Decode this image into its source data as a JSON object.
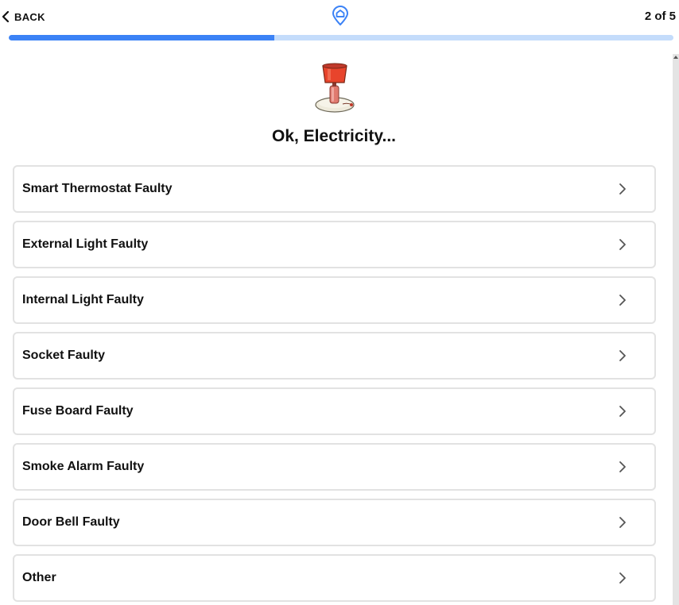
{
  "header": {
    "back_label": "BACK",
    "logo_icon": "home-pin-icon",
    "step_text": "2 of 5",
    "progress": 0.4
  },
  "illustration": "lamp-icon",
  "title": "Ok, Electricity...",
  "options": [
    {
      "label": "Smart Thermostat Faulty"
    },
    {
      "label": "External Light Faulty"
    },
    {
      "label": "Internal Light Faulty"
    },
    {
      "label": "Socket Faulty"
    },
    {
      "label": "Fuse Board Faulty"
    },
    {
      "label": "Smoke Alarm Faulty"
    },
    {
      "label": "Door Bell Faulty"
    },
    {
      "label": "Other"
    }
  ],
  "colors": {
    "accent": "#3b82f6",
    "progress_track": "#c4dcfb",
    "card_border": "#e2e2e2"
  }
}
